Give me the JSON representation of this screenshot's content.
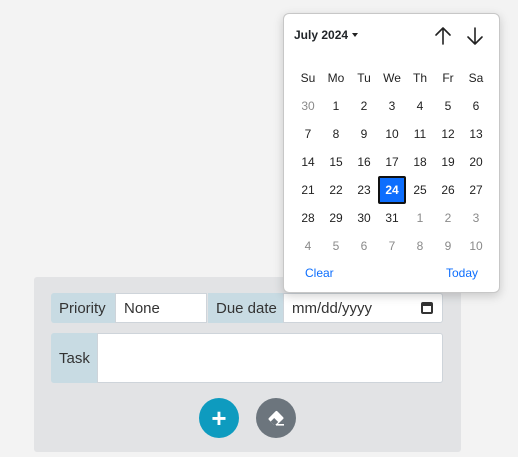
{
  "form": {
    "priority_label": "Priority",
    "priority_value": "None",
    "due_label": "Due date",
    "due_placeholder": "mm/dd/yyyy",
    "task_label": "Task",
    "task_value": "",
    "add_label": "+",
    "add_icon": "plus-icon",
    "clear_icon": "eraser-icon",
    "accent": "#0e9bbf"
  },
  "datepicker": {
    "month_label": "July 2024",
    "weekdays": [
      "Su",
      "Mo",
      "Tu",
      "We",
      "Th",
      "Fr",
      "Sa"
    ],
    "weeks": [
      [
        {
          "d": "30",
          "m": true
        },
        {
          "d": "1"
        },
        {
          "d": "2"
        },
        {
          "d": "3"
        },
        {
          "d": "4"
        },
        {
          "d": "5"
        },
        {
          "d": "6"
        }
      ],
      [
        {
          "d": "7"
        },
        {
          "d": "8"
        },
        {
          "d": "9"
        },
        {
          "d": "10"
        },
        {
          "d": "11"
        },
        {
          "d": "12"
        },
        {
          "d": "13"
        }
      ],
      [
        {
          "d": "14"
        },
        {
          "d": "15"
        },
        {
          "d": "16"
        },
        {
          "d": "17"
        },
        {
          "d": "18"
        },
        {
          "d": "19"
        },
        {
          "d": "20"
        }
      ],
      [
        {
          "d": "21"
        },
        {
          "d": "22"
        },
        {
          "d": "23"
        },
        {
          "d": "24",
          "sel": true
        },
        {
          "d": "25"
        },
        {
          "d": "26"
        },
        {
          "d": "27"
        }
      ],
      [
        {
          "d": "28"
        },
        {
          "d": "29"
        },
        {
          "d": "30"
        },
        {
          "d": "31"
        },
        {
          "d": "1",
          "m": true
        },
        {
          "d": "2",
          "m": true
        },
        {
          "d": "3",
          "m": true
        }
      ],
      [
        {
          "d": "4",
          "m": true
        },
        {
          "d": "5",
          "m": true
        },
        {
          "d": "6",
          "m": true
        },
        {
          "d": "7",
          "m": true
        },
        {
          "d": "8",
          "m": true
        },
        {
          "d": "9",
          "m": true
        },
        {
          "d": "10",
          "m": true
        }
      ]
    ],
    "clear_label": "Clear",
    "today_label": "Today",
    "selected_color": "#0d6efd",
    "prev_icon": "arrow-up-icon",
    "next_icon": "arrow-down-icon"
  }
}
